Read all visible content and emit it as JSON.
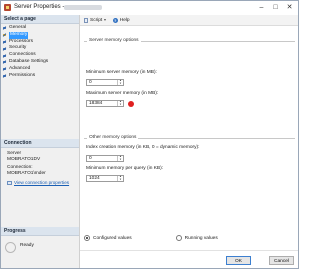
{
  "window": {
    "title": "Server Properties - "
  },
  "left_panel": {
    "select_page_header": "Select a page",
    "pages": [
      {
        "label": "General"
      },
      {
        "label": "Memory",
        "selected": true
      },
      {
        "label": "Processors"
      },
      {
        "label": "Security"
      },
      {
        "label": "Connections"
      },
      {
        "label": "Database Settings"
      },
      {
        "label": "Advanced"
      },
      {
        "label": "Permissions"
      }
    ],
    "connection_header": "Connection",
    "server_label": "Server",
    "server_value": "MOBRATO1DV",
    "connection_label": "Connection:",
    "connection_value": "MOBRATO1\\mder",
    "view_props_link": "View connection properties",
    "progress_header": "Progress",
    "progress_status": "Ready"
  },
  "toolbar": {
    "script_label": "Script",
    "help_label": "Help"
  },
  "server_memory": {
    "legend": "Server memory options",
    "min_label": "Minimum server memory (in MB):",
    "min_value": "0",
    "max_label": "Maximum server memory (in MB):",
    "max_value": "18384"
  },
  "other_memory": {
    "legend": "Other memory options",
    "index_label": "Index creation memory (in KB, 0 = dynamic memory):",
    "index_value": "0",
    "query_label": "Minimum memory per query (in KB):",
    "query_value": "1024"
  },
  "view_options": {
    "configured": "Configured values",
    "running": "Running values"
  },
  "buttons": {
    "ok": "OK",
    "cancel": "Cancel"
  },
  "colors": {
    "selection": "#3399ff",
    "indicator": "#e02020"
  }
}
